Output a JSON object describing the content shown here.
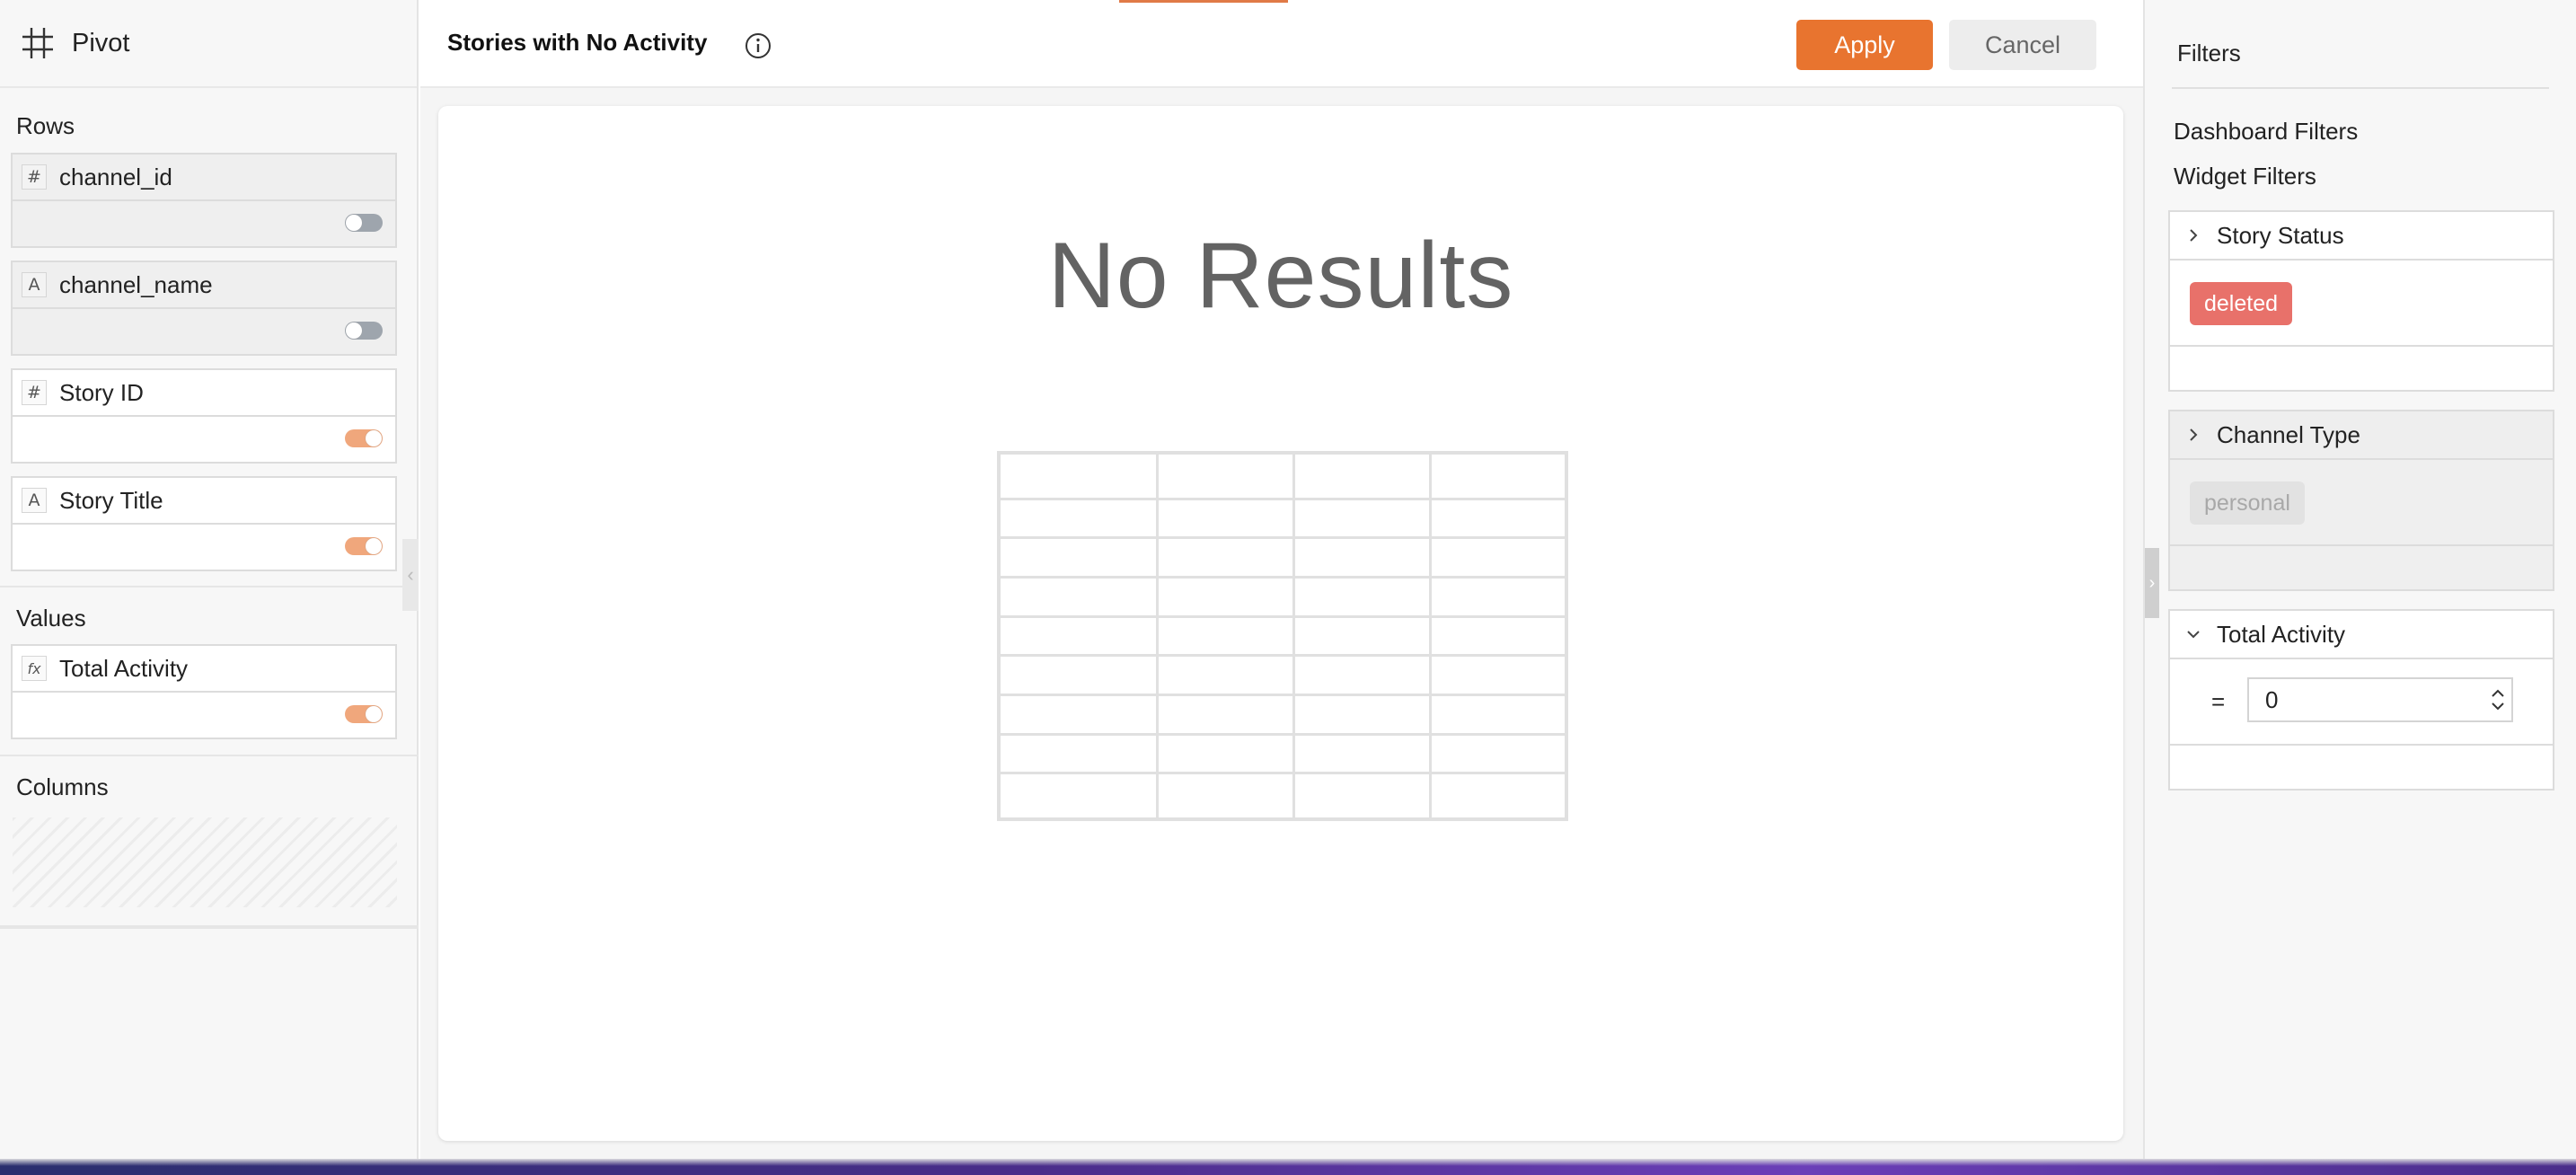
{
  "left_panel": {
    "title": "Pivot",
    "rows_label": "Rows",
    "values_label": "Values",
    "columns_label": "Columns",
    "rows": [
      {
        "type_glyph": "#",
        "name": "channel_id",
        "enabled": false
      },
      {
        "type_glyph": "A",
        "name": "channel_name",
        "enabled": false
      },
      {
        "type_glyph": "#",
        "name": "Story ID",
        "enabled": true
      },
      {
        "type_glyph": "A",
        "name": "Story Title",
        "enabled": true
      }
    ],
    "values": [
      {
        "type_glyph": "fx",
        "name": "Total Activity",
        "enabled": true
      }
    ]
  },
  "header": {
    "widget_title": "Stories with No Activity",
    "apply_label": "Apply",
    "cancel_label": "Cancel"
  },
  "canvas": {
    "empty_message": "No Results"
  },
  "filters_panel": {
    "title": "Filters",
    "dashboard_filters_label": "Dashboard Filters",
    "widget_filters_label": "Widget Filters",
    "filters": [
      {
        "name": "Story Status",
        "expanded": false,
        "value": "deleted"
      },
      {
        "name": "Channel Type",
        "expanded": false,
        "value": "personal"
      },
      {
        "name": "Total Activity",
        "expanded": true,
        "operator": "=",
        "value": "0"
      }
    ]
  },
  "colors": {
    "accent": "#e8742f",
    "deleted_tag": "#e8716a",
    "toggle_on": "#f0a77c",
    "toggle_off": "#9ea5ad"
  }
}
